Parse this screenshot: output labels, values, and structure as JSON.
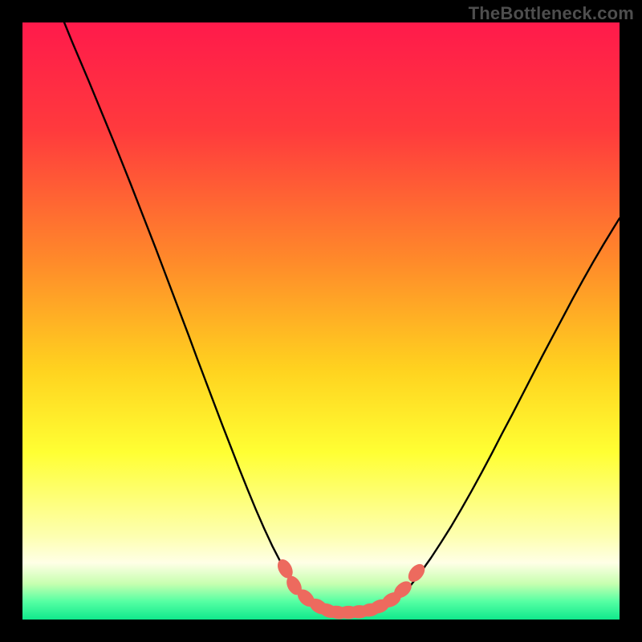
{
  "watermark": "TheBottleneck.com",
  "chart_data": {
    "type": "line",
    "title": "",
    "xlabel": "",
    "ylabel": "",
    "xlim": [
      0,
      1
    ],
    "ylim": [
      0,
      1
    ],
    "gradient_stops": [
      {
        "offset": 0.0,
        "color": "#ff1a4b"
      },
      {
        "offset": 0.18,
        "color": "#ff3a3d"
      },
      {
        "offset": 0.4,
        "color": "#ff8a2a"
      },
      {
        "offset": 0.58,
        "color": "#ffd21f"
      },
      {
        "offset": 0.72,
        "color": "#ffff33"
      },
      {
        "offset": 0.86,
        "color": "#fdffb0"
      },
      {
        "offset": 0.905,
        "color": "#ffffe6"
      },
      {
        "offset": 0.94,
        "color": "#c7ffb0"
      },
      {
        "offset": 0.97,
        "color": "#55ffa3"
      },
      {
        "offset": 1.0,
        "color": "#10e98c"
      }
    ],
    "series": [
      {
        "name": "left-curve",
        "color": "#000000",
        "points": [
          {
            "x": 0.07,
            "y": 1.0
          },
          {
            "x": 0.083,
            "y": 0.968
          },
          {
            "x": 0.097,
            "y": 0.935
          },
          {
            "x": 0.111,
            "y": 0.902
          },
          {
            "x": 0.125,
            "y": 0.868
          },
          {
            "x": 0.139,
            "y": 0.834
          },
          {
            "x": 0.153,
            "y": 0.8
          },
          {
            "x": 0.167,
            "y": 0.765
          },
          {
            "x": 0.181,
            "y": 0.73
          },
          {
            "x": 0.195,
            "y": 0.694
          },
          {
            "x": 0.209,
            "y": 0.658
          },
          {
            "x": 0.223,
            "y": 0.622
          },
          {
            "x": 0.237,
            "y": 0.585
          },
          {
            "x": 0.251,
            "y": 0.548
          },
          {
            "x": 0.265,
            "y": 0.511
          },
          {
            "x": 0.279,
            "y": 0.474
          },
          {
            "x": 0.293,
            "y": 0.436
          },
          {
            "x": 0.307,
            "y": 0.399
          },
          {
            "x": 0.321,
            "y": 0.362
          },
          {
            "x": 0.335,
            "y": 0.325
          },
          {
            "x": 0.349,
            "y": 0.289
          },
          {
            "x": 0.363,
            "y": 0.253
          },
          {
            "x": 0.377,
            "y": 0.218
          },
          {
            "x": 0.391,
            "y": 0.184
          },
          {
            "x": 0.405,
            "y": 0.152
          },
          {
            "x": 0.419,
            "y": 0.122
          },
          {
            "x": 0.433,
            "y": 0.095
          },
          {
            "x": 0.447,
            "y": 0.071
          },
          {
            "x": 0.461,
            "y": 0.05
          },
          {
            "x": 0.475,
            "y": 0.034
          },
          {
            "x": 0.489,
            "y": 0.022
          },
          {
            "x": 0.503,
            "y": 0.013
          },
          {
            "x": 0.517,
            "y": 0.008
          },
          {
            "x": 0.531,
            "y": 0.005
          }
        ]
      },
      {
        "name": "right-curve",
        "color": "#000000",
        "points": [
          {
            "x": 0.531,
            "y": 0.005
          },
          {
            "x": 0.548,
            "y": 0.005
          },
          {
            "x": 0.565,
            "y": 0.006
          },
          {
            "x": 0.582,
            "y": 0.009
          },
          {
            "x": 0.599,
            "y": 0.015
          },
          {
            "x": 0.616,
            "y": 0.025
          },
          {
            "x": 0.633,
            "y": 0.039
          },
          {
            "x": 0.65,
            "y": 0.057
          },
          {
            "x": 0.667,
            "y": 0.079
          },
          {
            "x": 0.684,
            "y": 0.103
          },
          {
            "x": 0.701,
            "y": 0.129
          },
          {
            "x": 0.718,
            "y": 0.156
          },
          {
            "x": 0.735,
            "y": 0.185
          },
          {
            "x": 0.752,
            "y": 0.215
          },
          {
            "x": 0.769,
            "y": 0.246
          },
          {
            "x": 0.786,
            "y": 0.278
          },
          {
            "x": 0.803,
            "y": 0.311
          },
          {
            "x": 0.82,
            "y": 0.343
          },
          {
            "x": 0.837,
            "y": 0.376
          },
          {
            "x": 0.854,
            "y": 0.409
          },
          {
            "x": 0.871,
            "y": 0.442
          },
          {
            "x": 0.888,
            "y": 0.474
          },
          {
            "x": 0.905,
            "y": 0.506
          },
          {
            "x": 0.922,
            "y": 0.538
          },
          {
            "x": 0.939,
            "y": 0.569
          },
          {
            "x": 0.956,
            "y": 0.599
          },
          {
            "x": 0.973,
            "y": 0.628
          },
          {
            "x": 0.99,
            "y": 0.656
          },
          {
            "x": 1.0,
            "y": 0.672
          }
        ]
      }
    ],
    "markers": {
      "color": "#ed6a5e",
      "rx": 0.011,
      "ry": 0.017,
      "points": [
        {
          "x": 0.44,
          "y": 0.085
        },
        {
          "x": 0.455,
          "y": 0.057
        },
        {
          "x": 0.475,
          "y": 0.036
        },
        {
          "x": 0.496,
          "y": 0.022
        },
        {
          "x": 0.512,
          "y": 0.015
        },
        {
          "x": 0.528,
          "y": 0.012
        },
        {
          "x": 0.546,
          "y": 0.012
        },
        {
          "x": 0.564,
          "y": 0.013
        },
        {
          "x": 0.582,
          "y": 0.016
        },
        {
          "x": 0.598,
          "y": 0.022
        },
        {
          "x": 0.618,
          "y": 0.033
        },
        {
          "x": 0.637,
          "y": 0.05
        },
        {
          "x": 0.66,
          "y": 0.078
        }
      ]
    }
  }
}
